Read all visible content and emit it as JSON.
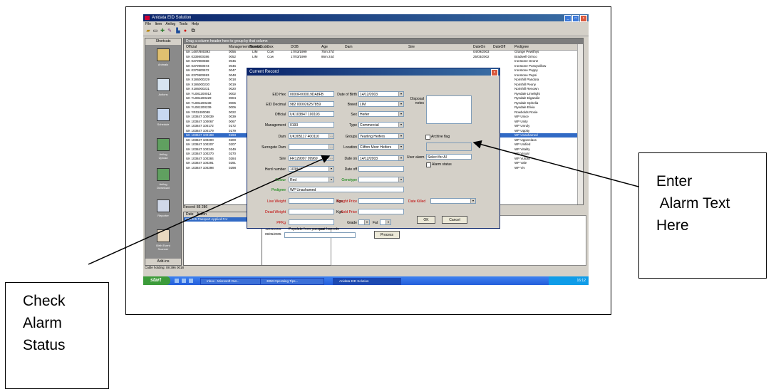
{
  "app": {
    "title": "Anidata EID Solution",
    "menus": [
      "File",
      "Item",
      "Anilog",
      "Tools",
      "Help"
    ]
  },
  "shortcuts": {
    "header": "Shortcuts",
    "items": [
      "Animals",
      "Actions",
      "Schedule",
      "Anilog Upload",
      "Anilog Download",
      "Reporter",
      "Birth Event Scanner"
    ],
    "footer": "Add-ins"
  },
  "grid": {
    "group_hint": "Drag a column header here to group by that column",
    "columns": [
      "Official",
      "ManagementNumber",
      "BreedCode",
      "Sex",
      "DOB",
      "Age",
      "Dam",
      "Sire",
      "DateOn",
      "DateOff",
      "Pedigree"
    ],
    "rows": [
      {
        "official": "UK 1487/800393",
        "mgmt": "0056",
        "breed": "LIM",
        "sex": "Cow",
        "dob": "17/03/1999",
        "age": "75m 27d",
        "dateon": "04/09/2003",
        "pedigree": "Grange Pewithys"
      },
      {
        "official": "UK 0339800386",
        "mgmt": "0052",
        "breed": "LIM",
        "sex": "Cow",
        "dob": "17/03/1999",
        "age": "86m 24d",
        "dateon": "25/03/2002",
        "pedigree": "Bradwell Orinco"
      },
      {
        "official": "UK 0370900558",
        "mgmt": "0045",
        "pedigree": "Ironstone Ozone"
      },
      {
        "official": "UK 0370900573",
        "mgmt": "0046",
        "pedigree": "Ironstone Pussywillow"
      },
      {
        "official": "UK 0370900572",
        "mgmt": "0047",
        "pedigree": "Ironstone Poppy"
      },
      {
        "official": "UK 0370900593",
        "mgmt": "0048",
        "pedigree": "Ironstone Pepsi"
      },
      {
        "official": "UK X186000229",
        "mgmt": "0018",
        "pedigree": "Noirshill Pandora"
      },
      {
        "official": "UK X186000230",
        "mgmt": "0019",
        "pedigree": "Noirshill Peony"
      },
      {
        "official": "UK X186000231",
        "mgmt": "0020",
        "pedigree": "Noirshill Renown"
      },
      {
        "official": "UK YL081200012",
        "mgmt": "0002",
        "pedigree": "Ryedale Limelight"
      },
      {
        "official": "UK YL081200229",
        "mgmt": "0004",
        "pedigree": "Ryedale Digandie"
      },
      {
        "official": "UK YL081200238",
        "mgmt": "0005",
        "pedigree": "Ryedale Ophelia"
      },
      {
        "official": "UK YL081200239",
        "mgmt": "0006",
        "pedigree": "Ryedale Elivia"
      },
      {
        "official": "UK YR02400088",
        "mgmt": "0022",
        "pedigree": "Rowbolds Rosie"
      },
      {
        "official": "UK 103847 100039",
        "mgmt": "0039",
        "pedigree": "WP Unice"
      },
      {
        "official": "UK 103847 100067",
        "mgmt": "0067",
        "pedigree": "WP Unity"
      },
      {
        "official": "UK 103847 100172",
        "mgmt": "0172",
        "pedigree": "WP Unruly"
      },
      {
        "official": "UK 103847 100179",
        "mgmt": "0179",
        "pedigree": "WP Uppity"
      },
      {
        "official": "UK 103847 100193",
        "mgmt": "0193",
        "pedigree": "WP Unashamed",
        "selected": true
      },
      {
        "official": "UK 103847 100200",
        "mgmt": "0200",
        "pedigree": "WP Upperclass"
      },
      {
        "official": "UK 103847 100207",
        "mgmt": "0207",
        "pedigree": "WP Unified"
      },
      {
        "official": "UK 103847 100249",
        "mgmt": "0249",
        "pedigree": "WP Vitality"
      },
      {
        "official": "UK 103847 100270",
        "mgmt": "0270",
        "pedigree": "WP Visual"
      },
      {
        "official": "UK 103847 100284",
        "mgmt": "0284",
        "pedigree": "WP Vulcan"
      },
      {
        "official": "UK 103847 100291",
        "mgmt": "0291",
        "pedigree": "WP Vale"
      },
      {
        "official": "UK 103847 100298",
        "mgmt": "0298",
        "pedigree": "WP Viv"
      }
    ],
    "record_label": "Record: 85 286"
  },
  "events": {
    "columns": [
      "Date",
      "Action"
    ],
    "selected_row": "03/2005 Passport Applied For"
  },
  "dates": [
    {
      "date": "16/03/2005",
      "num": "452"
    },
    {
      "date": "12/04/2005",
      "num": "485"
    },
    {
      "date": "09/05/2005",
      "num": "502"
    }
  ],
  "status_bar": "Cattle holding: 08 396 0018",
  "taskbar": {
    "start": "start",
    "tasks": [
      "Inbox - Microsoft Out...",
      "3050 Operating Tips...",
      "Anidata EID Solution"
    ],
    "clock": "16:12"
  },
  "dialog": {
    "title": "Current Record",
    "eid_hex_label": "EID Hex",
    "eid_hex": "0000F000019DA8FB",
    "eid_dec_label": "EID Decimal",
    "eid_dec": "982 000026257859",
    "official_label": "Official",
    "official": "UK103847 100193",
    "mgmt_label": "Management",
    "mgmt": "0193",
    "dam_label": "Dam",
    "dam": "UK305117 400110",
    "surrogate_label": "Surrogate Dam",
    "surrogate": "",
    "sire_label": "Sire",
    "sire": "FR129007 09969",
    "herd_label": "Herd number",
    "herd": "103847",
    "colour_label": "Colour",
    "colour": "Red",
    "pedigree_label": "Pedigree",
    "pedigree": "WP Unashamed",
    "live_weight_label": "Live Weight",
    "dead_weight_label": "Dead Weight",
    "ppkg_label": "PPKg",
    "kgs": "Kgs",
    "dob_label": "Date of Birth",
    "dob": "14/12/2003",
    "breed_label": "Breed",
    "breed": "LIM",
    "sex_label": "Sex",
    "sex": "Heifer",
    "type_label": "Type",
    "type": "Commercial",
    "groups_label": "Groups",
    "groups": "Yearling Heifers",
    "location_label": "Location",
    "location": "Clifton Moor Heifers",
    "date_on_label": "Date on",
    "date_on": "14/12/2003",
    "date_off_label": "Date off",
    "genotype_label": "Genotype",
    "bought_label": "Bought Price",
    "sold_label": "Sold Price",
    "grade_label": "Grade",
    "fat_label": "Fat",
    "date_killed_label": "Date Killed",
    "disposal_label": "Disposal notes",
    "archive_label": "Archive flag",
    "user_alarm_label": "User alarm",
    "user_alarm_value": "Select for Al",
    "alarm_status_label": "Alarm status",
    "populate_label": "Populate from passport barcode",
    "process_label": "Process",
    "ok_label": "OK",
    "cancel_label": "Cancel"
  },
  "callouts": {
    "enter_alarm": "Enter\n Alarm Text\nHere",
    "check_alarm": "Check\nAlarm\nStatus"
  }
}
